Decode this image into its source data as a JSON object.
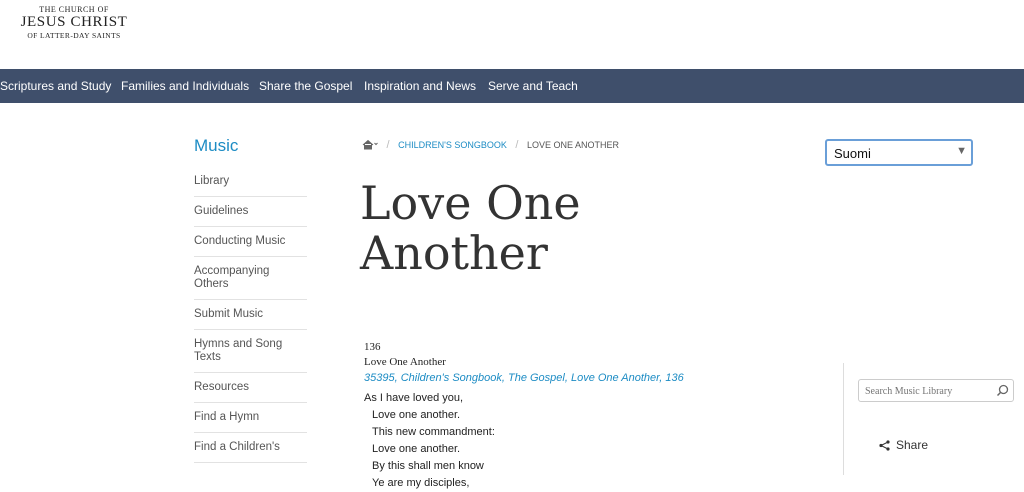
{
  "logo": {
    "line1": "THE CHURCH OF",
    "line2": "JESUS CHRIST",
    "line3": "OF LATTER-DAY SAINTS"
  },
  "nav": [
    "Scriptures and Study",
    "Families and Individuals",
    "Share the Gospel",
    "Inspiration and News",
    "Serve and Teach"
  ],
  "sidebar": {
    "title": "Music",
    "items": [
      "Library",
      "Guidelines",
      "Conducting Music",
      "Accompanying Others",
      "Submit Music",
      "Hymns and Song Texts",
      "Resources",
      "Find a Hymn",
      "Find a Children's"
    ]
  },
  "breadcrumb": {
    "link": "Children's Songbook",
    "current": "Love One Another"
  },
  "page_title": "Love One Another",
  "language": {
    "selected": "Suomi"
  },
  "song": {
    "number": "136",
    "title": "Love One Another",
    "tags": "35395, Children's Songbook, The Gospel, Love One Another, 136",
    "lyrics": [
      "As I have loved you,",
      "Love one another.",
      "This new commandment:",
      "Love one another.",
      "By this shall men know",
      "Ye are my disciples,"
    ]
  },
  "search": {
    "placeholder": "Search Music Library"
  },
  "share": {
    "label": "Share"
  }
}
